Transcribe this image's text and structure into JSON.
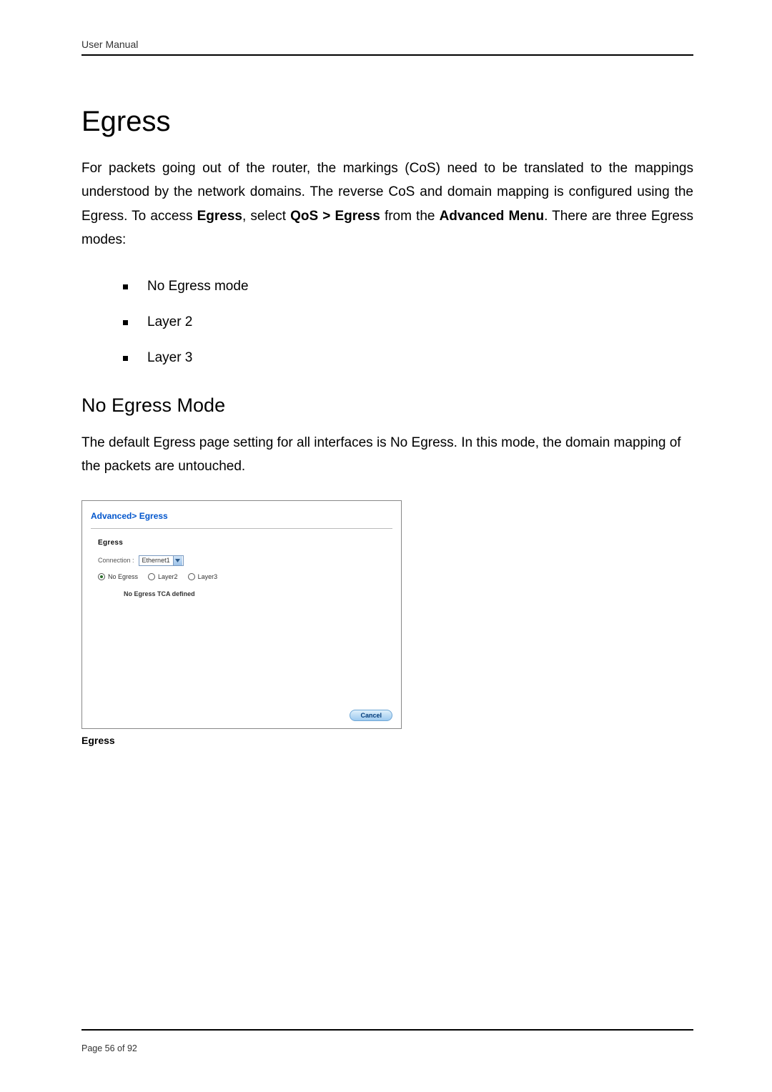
{
  "header": {
    "label": "User Manual"
  },
  "h1": "Egress",
  "intro": {
    "pre": "For packets going out of the router, the markings (CoS) need to be translated to the mappings understood by the network domains. The reverse CoS and domain mapping is configured using the Egress. To access ",
    "b1": "Egress",
    "mid1": ", select ",
    "b2": "QoS > Egress",
    "mid2": " from the ",
    "b3": "Advanced Menu",
    "post": ". There are three Egress modes:"
  },
  "bullets": [
    "No Egress mode",
    "Layer 2",
    "Layer 3"
  ],
  "h2": "No Egress Mode",
  "p2": "The default Egress page setting for all interfaces is No Egress. In this mode, the domain mapping of the packets are untouched.",
  "shot": {
    "breadcrumb": "Advanced> Egress",
    "section_label": "Egress",
    "connection_label": "Connection :",
    "connection_value": "Ethernet1",
    "radios": {
      "no_egress": "No Egress",
      "layer2": "Layer2",
      "layer3": "Layer3"
    },
    "no_tca": "No Egress TCA defined",
    "cancel": "Cancel"
  },
  "caption": "Egress",
  "footer": {
    "page": "Page 56 of 92"
  }
}
